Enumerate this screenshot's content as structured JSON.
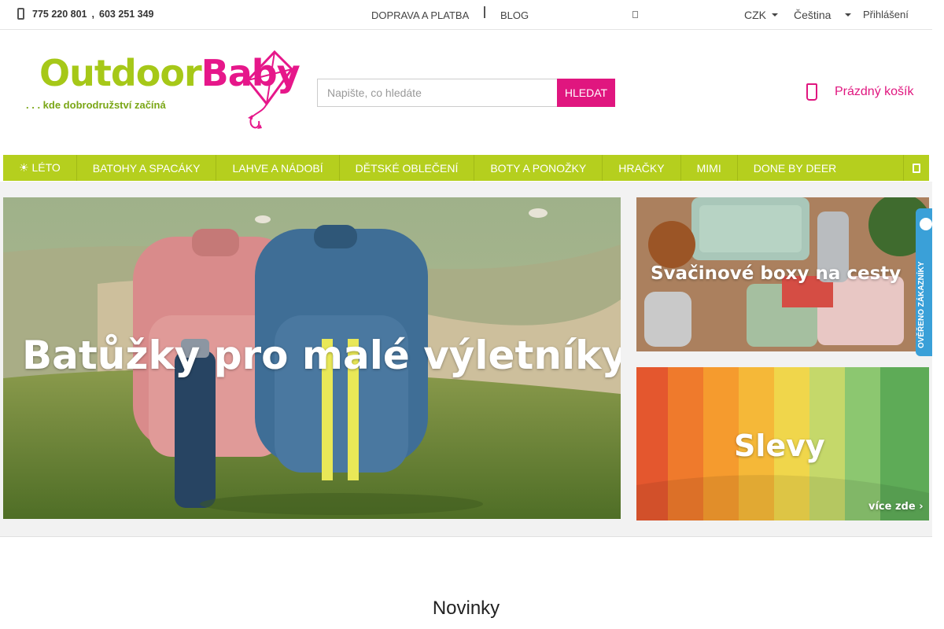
{
  "topbar": {
    "phone1": "775 220 801",
    "phone_sep": ",",
    "phone2": "603 251 349",
    "links": [
      "DOPRAVA A PLATBA",
      "BLOG"
    ],
    "currency": "CZK",
    "language": "Čeština",
    "login": "Přihlášení"
  },
  "logo": {
    "part1": "Outdoor",
    "part2": "Baby",
    "tagline": ". . . kde dobrodružství začíná"
  },
  "search": {
    "placeholder": "Napište, co hledáte",
    "button": "HLEDAT"
  },
  "cart": {
    "label": "Prázdný košík"
  },
  "nav": {
    "items": [
      "☀ LÉTO",
      "BATOHY A SPACÁKY",
      "LAHVE A NÁDOBÍ",
      "DĚTSKÉ OBLEČENÍ",
      "BOTY A PONOŽKY",
      "HRAČKY",
      "MIMI",
      "DONE BY DEER"
    ]
  },
  "banners": {
    "hero": "Batůžky pro malé výletníky",
    "side1": "Svačinové boxy na cesty",
    "side2": "Slevy",
    "side2_more": "více zde ›"
  },
  "badge": {
    "text": "OVĚŘENO ZÁKAZNÍKY"
  },
  "section": {
    "title": "Novinky"
  },
  "colors": {
    "brand_pink": "#e0167f",
    "brand_green": "#b5cf1e"
  }
}
